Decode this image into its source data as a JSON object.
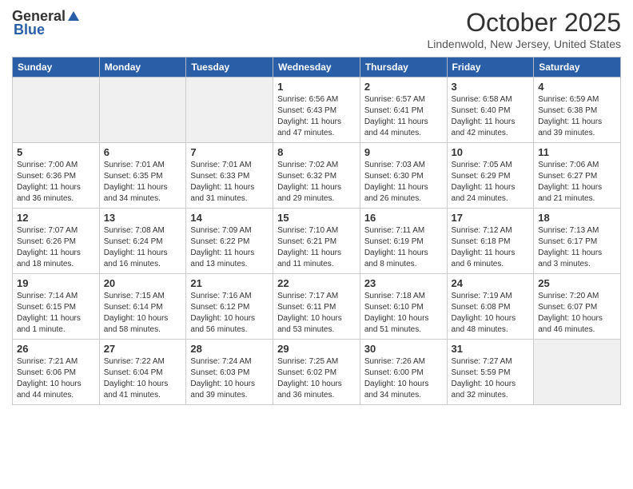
{
  "header": {
    "logo_general": "General",
    "logo_blue": "Blue",
    "title": "October 2025",
    "location": "Lindenwold, New Jersey, United States"
  },
  "weekdays": [
    "Sunday",
    "Monday",
    "Tuesday",
    "Wednesday",
    "Thursday",
    "Friday",
    "Saturday"
  ],
  "weeks": [
    [
      {
        "day": "",
        "info": "",
        "empty": true
      },
      {
        "day": "",
        "info": "",
        "empty": true
      },
      {
        "day": "",
        "info": "",
        "empty": true
      },
      {
        "day": "1",
        "info": "Sunrise: 6:56 AM\nSunset: 6:43 PM\nDaylight: 11 hours and 47 minutes."
      },
      {
        "day": "2",
        "info": "Sunrise: 6:57 AM\nSunset: 6:41 PM\nDaylight: 11 hours and 44 minutes."
      },
      {
        "day": "3",
        "info": "Sunrise: 6:58 AM\nSunset: 6:40 PM\nDaylight: 11 hours and 42 minutes."
      },
      {
        "day": "4",
        "info": "Sunrise: 6:59 AM\nSunset: 6:38 PM\nDaylight: 11 hours and 39 minutes."
      }
    ],
    [
      {
        "day": "5",
        "info": "Sunrise: 7:00 AM\nSunset: 6:36 PM\nDaylight: 11 hours and 36 minutes."
      },
      {
        "day": "6",
        "info": "Sunrise: 7:01 AM\nSunset: 6:35 PM\nDaylight: 11 hours and 34 minutes."
      },
      {
        "day": "7",
        "info": "Sunrise: 7:01 AM\nSunset: 6:33 PM\nDaylight: 11 hours and 31 minutes."
      },
      {
        "day": "8",
        "info": "Sunrise: 7:02 AM\nSunset: 6:32 PM\nDaylight: 11 hours and 29 minutes."
      },
      {
        "day": "9",
        "info": "Sunrise: 7:03 AM\nSunset: 6:30 PM\nDaylight: 11 hours and 26 minutes."
      },
      {
        "day": "10",
        "info": "Sunrise: 7:05 AM\nSunset: 6:29 PM\nDaylight: 11 hours and 24 minutes."
      },
      {
        "day": "11",
        "info": "Sunrise: 7:06 AM\nSunset: 6:27 PM\nDaylight: 11 hours and 21 minutes."
      }
    ],
    [
      {
        "day": "12",
        "info": "Sunrise: 7:07 AM\nSunset: 6:26 PM\nDaylight: 11 hours and 18 minutes."
      },
      {
        "day": "13",
        "info": "Sunrise: 7:08 AM\nSunset: 6:24 PM\nDaylight: 11 hours and 16 minutes."
      },
      {
        "day": "14",
        "info": "Sunrise: 7:09 AM\nSunset: 6:22 PM\nDaylight: 11 hours and 13 minutes."
      },
      {
        "day": "15",
        "info": "Sunrise: 7:10 AM\nSunset: 6:21 PM\nDaylight: 11 hours and 11 minutes."
      },
      {
        "day": "16",
        "info": "Sunrise: 7:11 AM\nSunset: 6:19 PM\nDaylight: 11 hours and 8 minutes."
      },
      {
        "day": "17",
        "info": "Sunrise: 7:12 AM\nSunset: 6:18 PM\nDaylight: 11 hours and 6 minutes."
      },
      {
        "day": "18",
        "info": "Sunrise: 7:13 AM\nSunset: 6:17 PM\nDaylight: 11 hours and 3 minutes."
      }
    ],
    [
      {
        "day": "19",
        "info": "Sunrise: 7:14 AM\nSunset: 6:15 PM\nDaylight: 11 hours and 1 minute."
      },
      {
        "day": "20",
        "info": "Sunrise: 7:15 AM\nSunset: 6:14 PM\nDaylight: 10 hours and 58 minutes."
      },
      {
        "day": "21",
        "info": "Sunrise: 7:16 AM\nSunset: 6:12 PM\nDaylight: 10 hours and 56 minutes."
      },
      {
        "day": "22",
        "info": "Sunrise: 7:17 AM\nSunset: 6:11 PM\nDaylight: 10 hours and 53 minutes."
      },
      {
        "day": "23",
        "info": "Sunrise: 7:18 AM\nSunset: 6:10 PM\nDaylight: 10 hours and 51 minutes."
      },
      {
        "day": "24",
        "info": "Sunrise: 7:19 AM\nSunset: 6:08 PM\nDaylight: 10 hours and 48 minutes."
      },
      {
        "day": "25",
        "info": "Sunrise: 7:20 AM\nSunset: 6:07 PM\nDaylight: 10 hours and 46 minutes."
      }
    ],
    [
      {
        "day": "26",
        "info": "Sunrise: 7:21 AM\nSunset: 6:06 PM\nDaylight: 10 hours and 44 minutes."
      },
      {
        "day": "27",
        "info": "Sunrise: 7:22 AM\nSunset: 6:04 PM\nDaylight: 10 hours and 41 minutes."
      },
      {
        "day": "28",
        "info": "Sunrise: 7:24 AM\nSunset: 6:03 PM\nDaylight: 10 hours and 39 minutes."
      },
      {
        "day": "29",
        "info": "Sunrise: 7:25 AM\nSunset: 6:02 PM\nDaylight: 10 hours and 36 minutes."
      },
      {
        "day": "30",
        "info": "Sunrise: 7:26 AM\nSunset: 6:00 PM\nDaylight: 10 hours and 34 minutes."
      },
      {
        "day": "31",
        "info": "Sunrise: 7:27 AM\nSunset: 5:59 PM\nDaylight: 10 hours and 32 minutes."
      },
      {
        "day": "",
        "info": "",
        "empty": true
      }
    ]
  ]
}
